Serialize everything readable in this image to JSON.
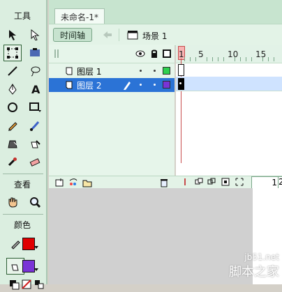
{
  "tools": {
    "title": "工具",
    "view_title": "查看",
    "color_title": "颜色",
    "items": [
      "selection-arrow",
      "subselection-arrow",
      "free-transform",
      "gradient-transform",
      "line",
      "lasso",
      "pen",
      "text",
      "oval",
      "rectangle",
      "pencil",
      "brush",
      "ink-bottle",
      "paint-bucket",
      "eyedropper",
      "eraser"
    ],
    "view_items": [
      "hand",
      "zoom"
    ],
    "stroke_color": "#e00000",
    "fill_color": "#7a33d6"
  },
  "document": {
    "tab_title": "未命名-1*"
  },
  "timeline": {
    "button_label": "时间轴",
    "scene_label": "场景 1",
    "layers": [
      {
        "name": "图层 1",
        "selected": false,
        "swatch": "#2fd14f"
      },
      {
        "name": "图层 2",
        "selected": true,
        "swatch": "#7a33d6"
      }
    ],
    "ruler_numbers": [
      "1",
      "5",
      "10",
      "15"
    ],
    "current_frame": "1",
    "next_field_partial": "2"
  },
  "watermark": {
    "small": "jb51.net",
    "big": "脚本之家"
  }
}
